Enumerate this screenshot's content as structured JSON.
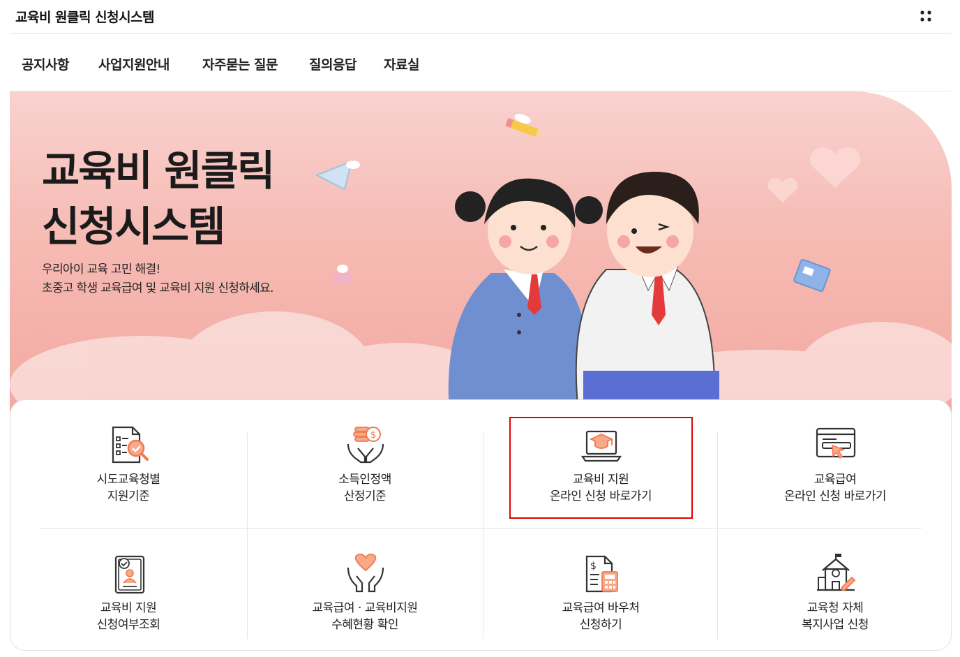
{
  "header": {
    "site_title": "교육비 원클릭 신청시스템",
    "menu_icon": "grid-dots-icon"
  },
  "nav": {
    "items": [
      {
        "label": "공지사항"
      },
      {
        "label": "사업지원안내"
      },
      {
        "label": "자주묻는 질문"
      },
      {
        "label": "질의응답"
      },
      {
        "label": "자료실"
      }
    ]
  },
  "hero": {
    "title_line1": "교육비 원클릭",
    "title_line2": "신청시스템",
    "sub_line1": "우리아이 교육 고민 해결!",
    "sub_line2": "초중고 학생 교육급여 및 교육비 지원 신청하세요."
  },
  "services": [
    {
      "line1": "시도교육청별",
      "line2": "지원기준",
      "icon": "document-search-icon"
    },
    {
      "line1": "소득인정액",
      "line2": "산정기준",
      "icon": "coins-hands-icon"
    },
    {
      "line1": "교육비 지원",
      "line2": "온라인 신청 바로가기",
      "icon": "laptop-graduation-cap-icon"
    },
    {
      "line1": "교육급여",
      "line2": "온라인 신청 바로가기",
      "icon": "browser-click-icon"
    },
    {
      "line1": "교육비 지원",
      "line2": "신청여부조회",
      "icon": "profile-document-icon"
    },
    {
      "line1": "교육급여 · 교육비지원",
      "line2": "수혜현황 확인",
      "icon": "heart-hands-icon"
    },
    {
      "line1": "교육급여 바우처",
      "line2": "신청하기",
      "icon": "invoice-calculator-icon"
    },
    {
      "line1": "교육청 자체",
      "line2": "복지사업 신청",
      "icon": "school-pencil-icon"
    }
  ],
  "colors": {
    "accent": "#f07a4f",
    "outline": "#333333",
    "highlight": "#e00000",
    "hero_bg": "#f6bbb4"
  }
}
